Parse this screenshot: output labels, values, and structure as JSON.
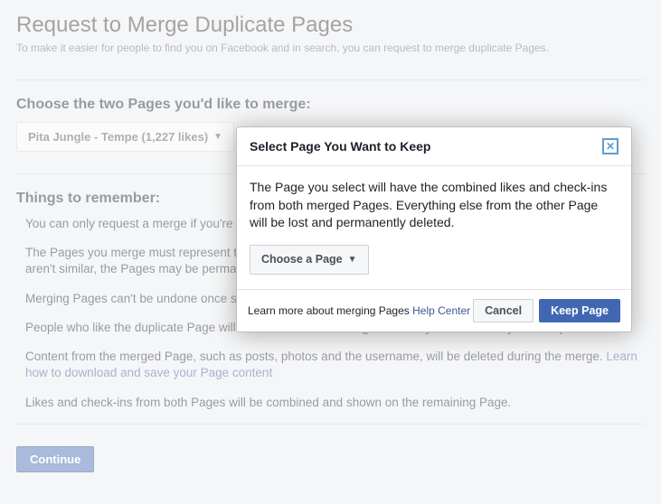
{
  "page": {
    "title": "Request to Merge Duplicate Pages",
    "subtitle": "To make it easier for people to find you on Facebook and in search, you can request to merge duplicate Pages."
  },
  "choose": {
    "heading": "Choose the two Pages you'd like to merge:",
    "selected_page": "Pita Jungle - Tempe (1,227 likes)"
  },
  "things": {
    "heading": "Things to remember:",
    "items": [
      "You can only request a merge if you're an admin of both Pages.",
      "The Pages you merge must represent the same thing and have similar names. If you try to merge Pages that aren't similar, the Pages may be permanently unable to be merged.",
      "Merging Pages can't be undone once started.",
      "People who like the duplicate Page will be informed of the merge. This may take a few days to complete.",
      "Content from the merged Page, such as posts, photos and the username, will be deleted during the merge. ",
      "Likes and check-ins from both Pages will be combined and shown on the remaining Page."
    ],
    "download_link": "Learn how to download and save your Page content"
  },
  "continue_label": "Continue",
  "dialog": {
    "title": "Select Page You Want to Keep",
    "body": "The Page you select will have the combined likes and check-ins from both merged Pages. Everything else from the other Page will be lost and permanently deleted.",
    "choose_label": "Choose a Page",
    "footer_text": "Learn more about merging Pages ",
    "help_link": "Help Center",
    "cancel": "Cancel",
    "keep": "Keep Page"
  }
}
